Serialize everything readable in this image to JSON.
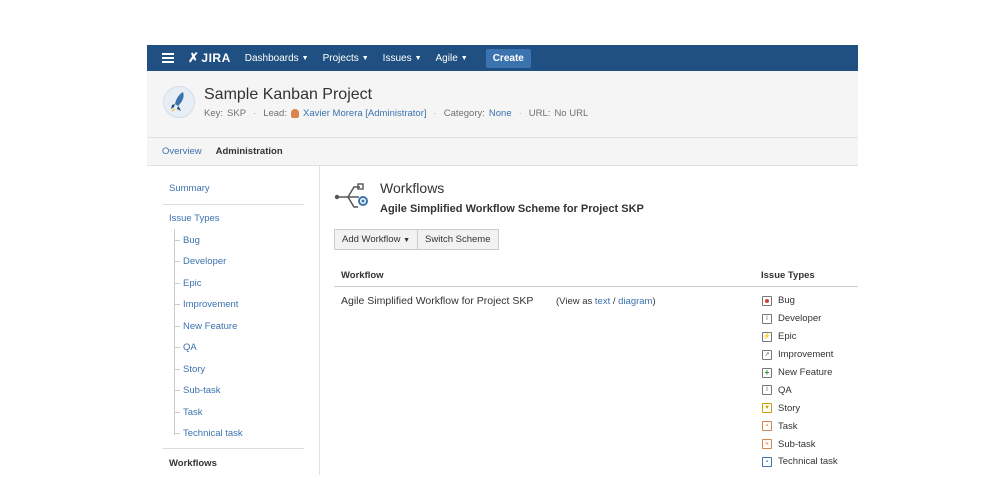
{
  "nav": {
    "logo": "JIRA",
    "items": [
      "Dashboards",
      "Projects",
      "Issues",
      "Agile"
    ],
    "create_label": "Create"
  },
  "project": {
    "title": "Sample Kanban Project",
    "key_label": "Key:",
    "key_value": "SKP",
    "lead_label": "Lead:",
    "lead_value": "Xavier Morera [Administrator]",
    "category_label": "Category:",
    "category_value": "None",
    "url_label": "URL:",
    "url_value": "No URL"
  },
  "tabs": [
    "Overview",
    "Administration"
  ],
  "sidebar": {
    "summary": "Summary",
    "issue_types": "Issue Types",
    "subitems": [
      "Bug",
      "Developer",
      "Epic",
      "Improvement",
      "New Feature",
      "QA",
      "Story",
      "Sub-task",
      "Task",
      "Technical task"
    ],
    "workflows": "Workflows"
  },
  "main": {
    "title": "Workflows",
    "subtitle": "Agile Simplified Workflow Scheme for Project SKP",
    "add_workflow": "Add Workflow",
    "switch_scheme": "Switch Scheme",
    "col_workflow": "Workflow",
    "col_issue_types": "Issue Types",
    "workflow_name": "Agile Simplified Workflow for Project SKP",
    "view_as_open": "(View as",
    "view_text": "text",
    "view_slash": "/",
    "view_diagram": "diagram",
    "view_as_close": ")",
    "issue_types": [
      {
        "name": "Bug",
        "icon": "bug-icon",
        "color": "#d04437"
      },
      {
        "name": "Developer",
        "icon": "developer-icon",
        "color": "#555555"
      },
      {
        "name": "Epic",
        "icon": "epic-icon",
        "color": "#555555"
      },
      {
        "name": "Improvement",
        "icon": "improvement-icon",
        "color": "#555555"
      },
      {
        "name": "New Feature",
        "icon": "new-feature-icon",
        "color": "#14892c"
      },
      {
        "name": "QA",
        "icon": "qa-icon",
        "color": "#555555"
      },
      {
        "name": "Story",
        "icon": "story-icon",
        "color": "#f6c342"
      },
      {
        "name": "Task",
        "icon": "task-icon",
        "color": "#d9844a"
      },
      {
        "name": "Sub-task",
        "icon": "sub-task-icon",
        "color": "#d9844a"
      },
      {
        "name": "Technical task",
        "icon": "technical-task-icon",
        "color": "#3b73af"
      }
    ]
  },
  "colors": {
    "nav_bg": "#205081",
    "create_bg": "#3b73af",
    "link": "#3b73af"
  }
}
